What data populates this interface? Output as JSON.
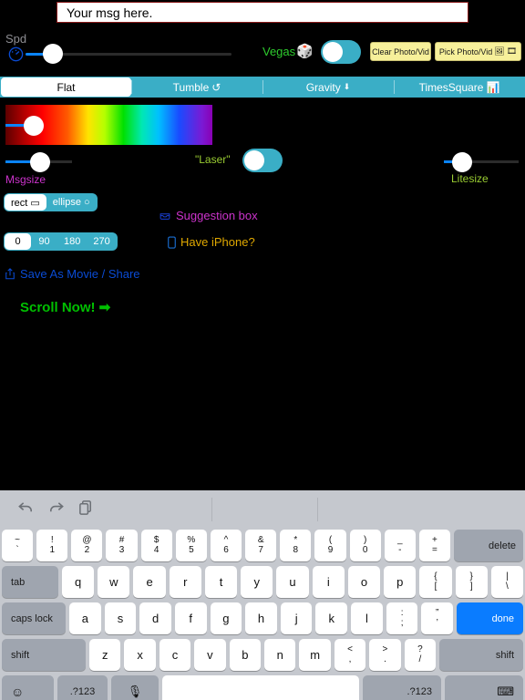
{
  "message_field": {
    "value": "Your msg here.",
    "placeholder": "Your msg here."
  },
  "speed": {
    "label": "Spd",
    "icon": "speedometer-icon"
  },
  "vegas": {
    "label": "Vegas",
    "dice": "🎲",
    "toggle_on": true
  },
  "photo_buttons": {
    "clear": "Clear Photo/Vid",
    "pick": "Pick Photo/Vid",
    "pick_icon_1": "🖼",
    "pick_icon_2": "🎞"
  },
  "tabs": [
    {
      "label": "Flat",
      "icon": "",
      "active": true
    },
    {
      "label": "Tumble",
      "icon": "↺",
      "active": false
    },
    {
      "label": "Gravity",
      "icon": "⬇",
      "active": false
    },
    {
      "label": "TimesSquare",
      "icon": "📊",
      "active": false
    }
  ],
  "msgsize": {
    "label": "Msgsize"
  },
  "laser": {
    "label": "\"Laser\"",
    "toggle_on": true
  },
  "litesize": {
    "label": "Litesize"
  },
  "shape_segment": {
    "options": [
      "rect ▭",
      "ellipse ○"
    ],
    "selected": 0
  },
  "rotation_segment": {
    "options": [
      "0",
      "90",
      "180",
      "270"
    ],
    "selected": 0
  },
  "links": {
    "suggestion": "Suggestion box",
    "iphone": "Have iPhone?",
    "save": "Save As Movie / Share"
  },
  "scroll_now": "Scroll Now! ➡",
  "keyboard": {
    "toolbar": [
      "undo-icon",
      "redo-icon",
      "paste-icon"
    ],
    "row_numbers": [
      {
        "up": "~",
        "lo": "`"
      },
      {
        "up": "!",
        "lo": "1"
      },
      {
        "up": "@",
        "lo": "2"
      },
      {
        "up": "#",
        "lo": "3"
      },
      {
        "up": "$",
        "lo": "4"
      },
      {
        "up": "%",
        "lo": "5"
      },
      {
        "up": "^",
        "lo": "6"
      },
      {
        "up": "&",
        "lo": "7"
      },
      {
        "up": "*",
        "lo": "8"
      },
      {
        "up": "(",
        "lo": "9"
      },
      {
        "up": ")",
        "lo": "0"
      },
      {
        "up": "_",
        "lo": "-"
      },
      {
        "up": "+",
        "lo": "="
      }
    ],
    "delete_label": "delete",
    "tab_label": "tab",
    "row_q": [
      "q",
      "w",
      "e",
      "r",
      "t",
      "y",
      "u",
      "i",
      "o",
      "p"
    ],
    "row_q_dual": [
      {
        "up": "{",
        "lo": "["
      },
      {
        "up": "}",
        "lo": "]"
      },
      {
        "up": "|",
        "lo": "\\"
      }
    ],
    "caps_label": "caps lock",
    "row_a": [
      "a",
      "s",
      "d",
      "f",
      "g",
      "h",
      "j",
      "k",
      "l"
    ],
    "row_a_dual": [
      {
        "up": ":",
        "lo": ";"
      },
      {
        "up": "”",
        "lo": "’"
      }
    ],
    "done_label": "done",
    "shift_label": "shift",
    "row_z": [
      "z",
      "x",
      "c",
      "v",
      "b",
      "n",
      "m"
    ],
    "row_z_dual": [
      {
        "up": "<",
        "lo": ","
      },
      {
        "up": ">",
        "lo": "."
      },
      {
        "up": "?",
        "lo": "/"
      }
    ],
    "emoji_icon": "☺",
    "num_left": ".?123",
    "mic_icon": "🎙",
    "space": "",
    "num_right": ".?123",
    "hide_icon": "⌨"
  },
  "colors": {
    "accent_teal": "#3aaec6",
    "slider_blue": "#0a84ff",
    "done_blue": "#0a7cff",
    "green": "#2ecc2e",
    "magenta": "#cc33cc",
    "gold": "#e0a800",
    "link_blue": "#0a4bd4",
    "scroll_green": "#00c000",
    "yellow_btn": "#f7f09a"
  }
}
